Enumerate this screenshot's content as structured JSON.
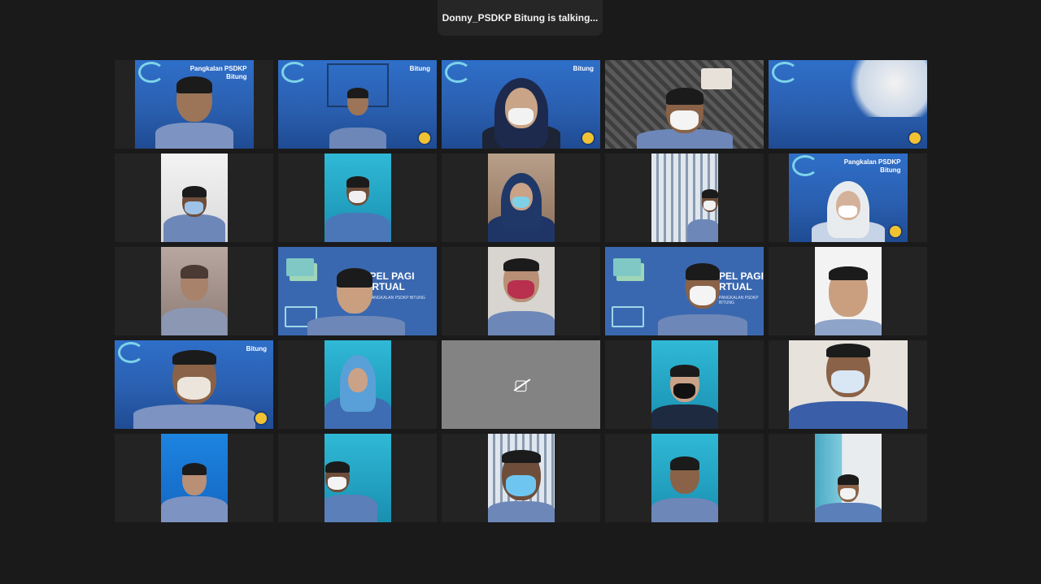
{
  "talking_indicator": {
    "text": "Donny_PSDKP Bitung is talking..."
  },
  "banners": {
    "pangkalan_two_line": "Pangkalan PSDKP\nBitung",
    "bitung": "Bitung",
    "apel_title_1": "APEL PAGI",
    "apel_title_2": "VIRTUAL",
    "apel_title_partial_1": "PEL PAGI",
    "apel_title_partial_2": "RTUAL",
    "apel_sub": "PANGKALAN PSDKP BITUNG"
  },
  "participants": [
    {
      "video": true
    },
    {
      "video": true
    },
    {
      "video": true
    },
    {
      "video": true
    },
    {
      "video": true
    },
    {
      "video": true
    },
    {
      "video": true
    },
    {
      "video": true
    },
    {
      "video": true
    },
    {
      "video": true
    },
    {
      "video": true
    },
    {
      "video": true
    },
    {
      "video": true
    },
    {
      "video": true
    },
    {
      "video": true
    },
    {
      "video": true
    },
    {
      "video": true
    },
    {
      "video": false,
      "icon": "camera-off-icon"
    },
    {
      "video": true
    },
    {
      "video": true
    },
    {
      "video": true
    },
    {
      "video": true
    },
    {
      "video": true
    },
    {
      "video": true
    },
    {
      "video": true
    }
  ]
}
